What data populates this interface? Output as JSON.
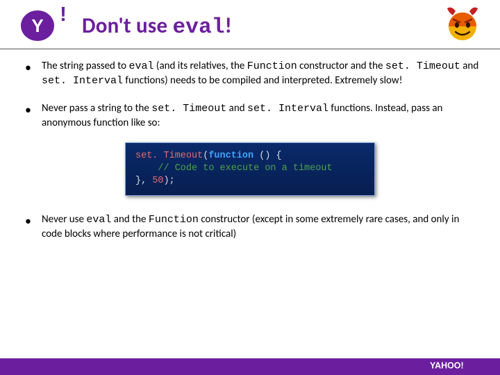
{
  "header": {
    "title_pre": "Don't use ",
    "title_code": "eval",
    "title_post": "!"
  },
  "bullets": [
    {
      "parts": [
        {
          "t": "plain",
          "v": "The string passed to "
        },
        {
          "t": "code",
          "v": "eval"
        },
        {
          "t": "plain",
          "v": " (and its relatives, the "
        },
        {
          "t": "code",
          "v": "Function"
        },
        {
          "t": "plain",
          "v": " constructor and the "
        },
        {
          "t": "code",
          "v": "set. Timeout"
        },
        {
          "t": "plain",
          "v": " and "
        },
        {
          "t": "code",
          "v": "set. Interval"
        },
        {
          "t": "plain",
          "v": " functions) needs to be compiled and interpreted. Extremely slow!"
        }
      ]
    },
    {
      "parts": [
        {
          "t": "plain",
          "v": "Never pass a string to the "
        },
        {
          "t": "code",
          "v": "set. Timeout"
        },
        {
          "t": "plain",
          "v": " and "
        },
        {
          "t": "code",
          "v": "set. Interval"
        },
        {
          "t": "plain",
          "v": " functions. Instead, pass an anonymous function like so:"
        }
      ]
    },
    {
      "parts": [
        {
          "t": "plain",
          "v": "Never use "
        },
        {
          "t": "code",
          "v": "eval"
        },
        {
          "t": "plain",
          "v": " and the "
        },
        {
          "t": "code",
          "v": "Function"
        },
        {
          "t": "plain",
          "v": " constructor (except in some extremely rare cases, and only in code blocks where performance is not critical)"
        }
      ]
    }
  ],
  "code": {
    "line1": {
      "fn": "set. Timeout",
      "open": "(",
      "kw": "function ",
      "args": "() {"
    },
    "line2": {
      "indent": "    ",
      "cmt": "// Code to execute on a timeout"
    },
    "line3": {
      "close": "}, ",
      "num": "50",
      "end": ");"
    }
  },
  "icons": {
    "yahoo": "yahoo-logo",
    "devil": "devil-icon",
    "yahoo_footer": "yahoo-footer-logo"
  }
}
